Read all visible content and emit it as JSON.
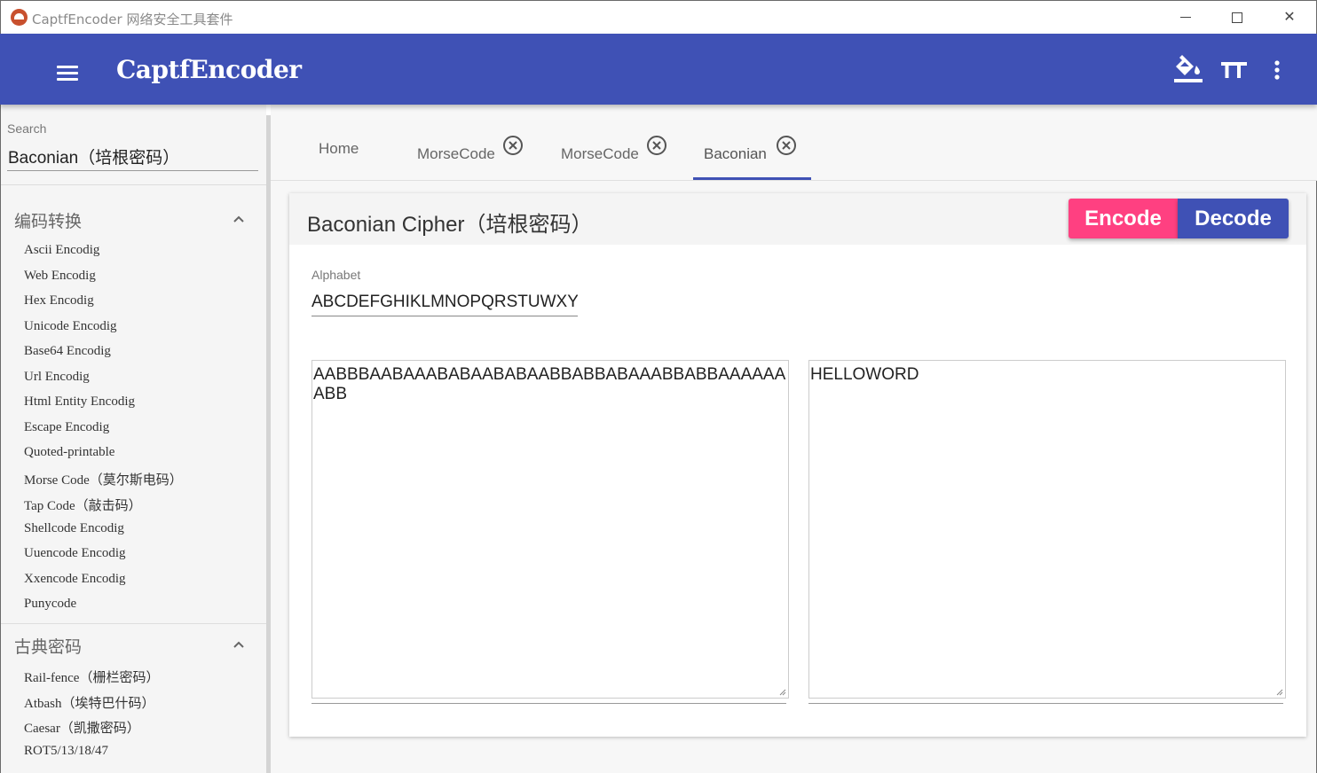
{
  "window": {
    "title": "CaptfEncoder 网络安全工具套件",
    "minimize_label": "",
    "maximize_label": "",
    "close_label": "✕"
  },
  "appbar": {
    "title": "CaptfEncoder",
    "icons": [
      "menu-icon",
      "paint-bucket-icon",
      "text-size-icon",
      "more-vert-icon"
    ]
  },
  "sidebar": {
    "search_label": "Search",
    "search_value": "Baconian（培根密码）",
    "sections": [
      {
        "label": "编码转换",
        "items": [
          "Ascii Encodig",
          "Web Encodig",
          "Hex Encodig",
          "Unicode Encodig",
          "Base64 Encodig",
          "Url Encodig",
          "Html Entity Encodig",
          "Escape Encodig",
          "Quoted-printable",
          "Morse Code（莫尔斯电码）",
          "Tap Code（敲击码）",
          "Shellcode Encodig",
          "Uuencode Encodig",
          "Xxencode Encodig",
          "Punycode"
        ]
      },
      {
        "label": "古典密码",
        "items": [
          "Rail-fence（栅栏密码）",
          "Atbash（埃特巴什码）",
          "Caesar（凯撒密码）",
          "ROT5/13/18/47"
        ]
      }
    ]
  },
  "tabs": [
    {
      "label": "Home",
      "closable": false
    },
    {
      "label": "MorseCode",
      "closable": true
    },
    {
      "label": "MorseCode",
      "closable": true
    },
    {
      "label": "Baconian",
      "closable": true,
      "active": true
    }
  ],
  "card": {
    "title": "Baconian Cipher（培根密码）",
    "encode_label": "Encode",
    "decode_label": "Decode",
    "alphabet_label": "Alphabet",
    "alphabet_value": "ABCDEFGHIKLMNOPQRSTUWXYZ",
    "input_text": "AABBBAABAAABABAABABAABBABBABAAABBABBAAAAAAABB",
    "output_text": "HELLOWORD"
  },
  "colors": {
    "primary": "#3f51b5",
    "accent": "#ff4081"
  }
}
